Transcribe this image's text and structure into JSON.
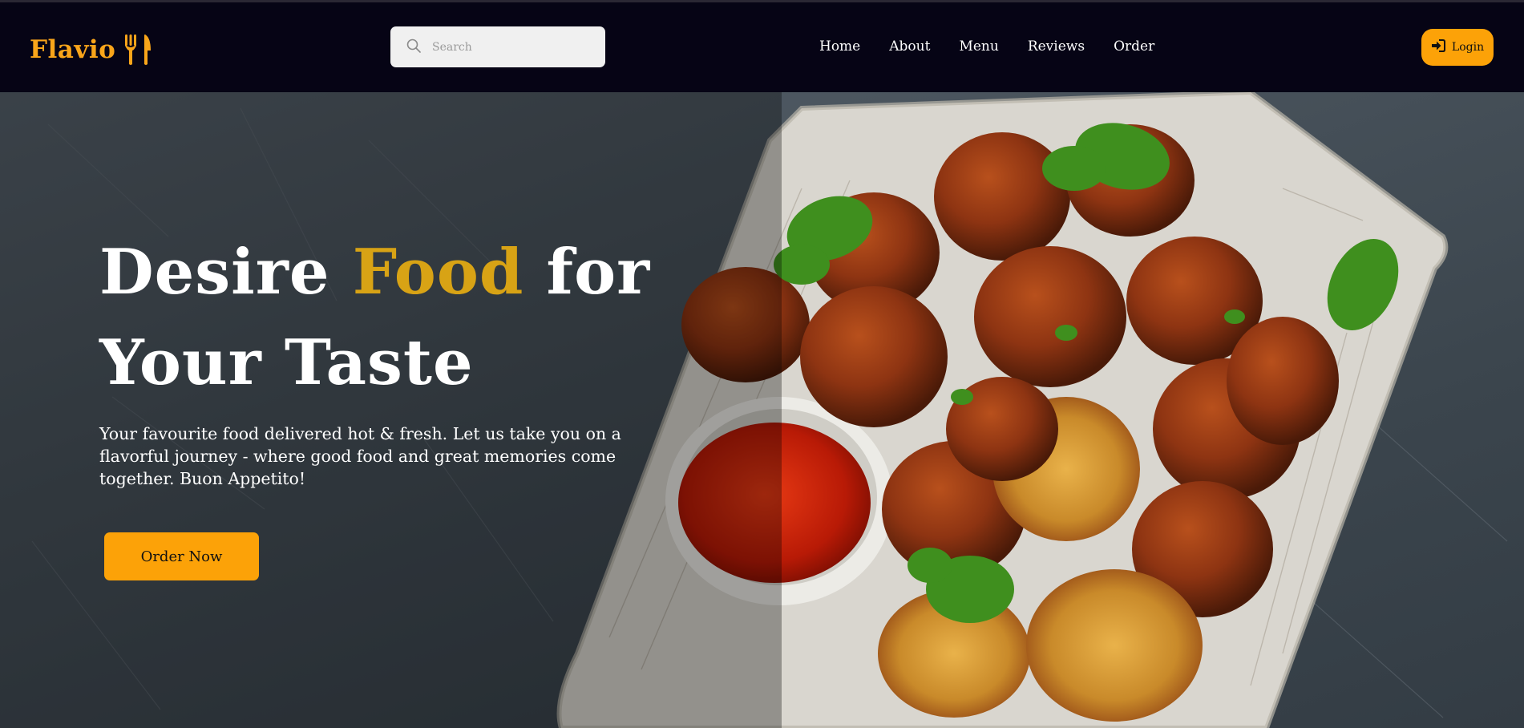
{
  "brand": {
    "name": "Flavio",
    "icon": "fork-knife-icon",
    "color": "#f9a51a"
  },
  "search": {
    "placeholder": "Search",
    "value": ""
  },
  "nav": {
    "links": [
      {
        "label": "Home"
      },
      {
        "label": "About"
      },
      {
        "label": "Menu"
      },
      {
        "label": "Reviews"
      },
      {
        "label": "Order"
      }
    ]
  },
  "login": {
    "label": "Login",
    "icon": "sign-in-icon"
  },
  "hero": {
    "title_part1": "Desire",
    "title_accent": "Food",
    "title_part2": "for Your Taste",
    "description": "Your favourite food delivered hot & fresh. Let us take you on a flavorful journey - where good food and great memories come together. Buon Appetito!",
    "cta_label": "Order Now",
    "image": "fried fritters with cilantro and red chili dipping sauce on a white wooden board"
  },
  "colors": {
    "accent": "#fca208",
    "title_accent": "#d8a315",
    "navbar_bg": "#060415"
  }
}
